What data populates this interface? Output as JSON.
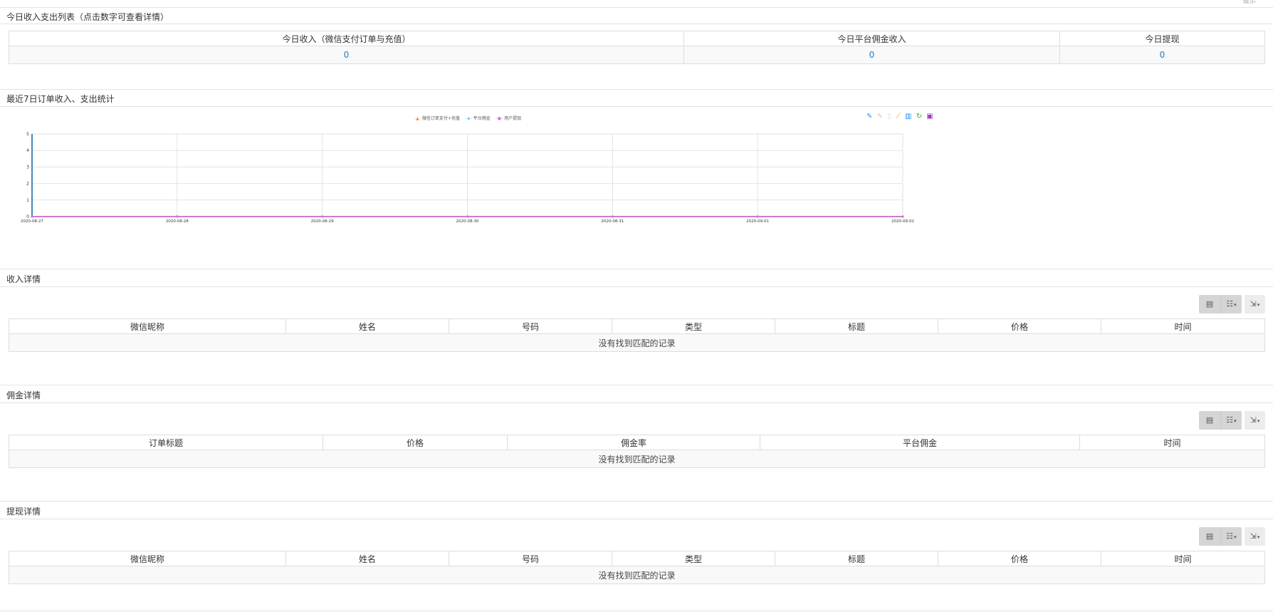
{
  "top_corner": "提示",
  "today": {
    "title": "今日收入支出列表（点击数字可查看详情）",
    "headers": [
      "今日收入（微信支付订单与充值）",
      "今日平台佣金收入",
      "今日提现"
    ],
    "values": [
      "0",
      "0",
      "0"
    ]
  },
  "chart_section": {
    "title": "最近7日订单收入、支出统计",
    "tool_icons": [
      "mark-icon",
      "mark-undo-icon",
      "mark-clear-icon",
      "line-chart-icon",
      "bar-chart-icon",
      "refresh-icon",
      "save-image-icon"
    ]
  },
  "chart_data": {
    "type": "line",
    "title": "",
    "xlabel": "",
    "ylabel": "",
    "x": [
      "2020-08-27",
      "2020-08-28",
      "2020-08-29",
      "2020-08-30",
      "2020-08-31",
      "2020-09-01",
      "2020-09-02"
    ],
    "ylim": [
      0,
      5
    ],
    "yticks": [
      "0",
      "1",
      "2",
      "3",
      "4",
      "5"
    ],
    "grid": true,
    "legend_position": "top-center",
    "series": [
      {
        "name": "微信订单支付+充值",
        "values": [
          0,
          0,
          0,
          0,
          0,
          0,
          0
        ],
        "color": "#ff7f50",
        "marker": "triangle"
      },
      {
        "name": "平台佣金",
        "values": [
          0,
          0,
          0,
          0,
          0,
          0,
          0
        ],
        "color": "#87cefa",
        "marker": "diamond"
      },
      {
        "name": "用户提现",
        "values": [
          0,
          0,
          0,
          0,
          0,
          0,
          0
        ],
        "color": "#da70d6",
        "marker": "circle"
      }
    ]
  },
  "income": {
    "title": "收入详情",
    "headers": [
      "微信昵称",
      "姓名",
      "号码",
      "类型",
      "标题",
      "价格",
      "时间"
    ],
    "empty": "没有找到匹配的记录"
  },
  "commission": {
    "title": "佣金详情",
    "headers": [
      "订单标题",
      "价格",
      "佣金率",
      "平台佣金",
      "时间"
    ],
    "empty": "没有找到匹配的记录"
  },
  "withdraw": {
    "title": "提现详情",
    "headers": [
      "微信昵称",
      "姓名",
      "号码",
      "类型",
      "标题",
      "价格",
      "时间"
    ],
    "empty": "没有找到匹配的记录"
  },
  "toolbar": {
    "card_view_icon": "card-view-icon",
    "columns_icon": "columns-icon",
    "export_icon": "export-icon",
    "caret": "▾"
  },
  "colors": {
    "link": "#1e7fc3",
    "axis": "#48b",
    "toolbar_bg": "#d5d5d5"
  }
}
